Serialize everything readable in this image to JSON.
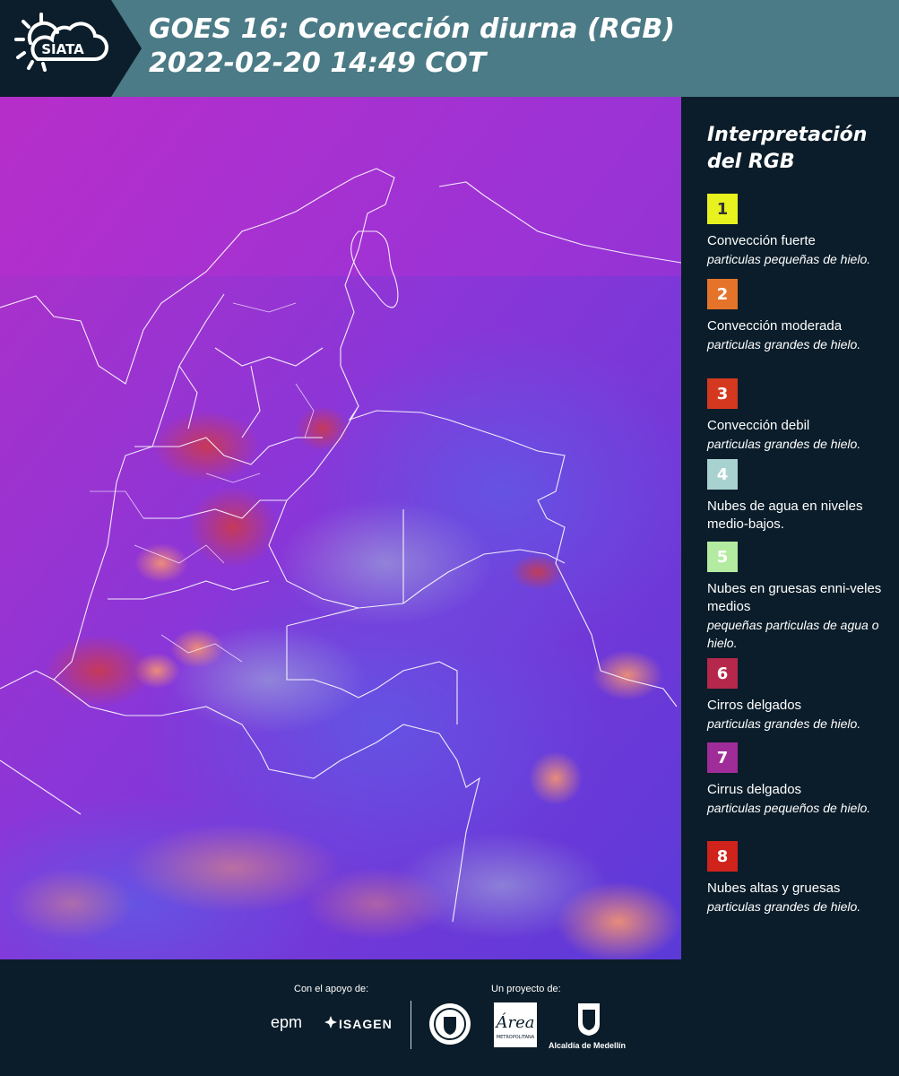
{
  "header": {
    "logo_text": "SIATA",
    "title": "GOES 16: Convección diurna (RGB)\n 2022-02-20 14:49 COT"
  },
  "legend": {
    "title": "Interpretación\ndel RGB",
    "items": [
      {
        "number": "1",
        "color": "#e8f21e",
        "label": "Convección fuerte",
        "desc": "particulas pequeñas de hielo.",
        "text_color": "#333333"
      },
      {
        "number": "2",
        "color": "#e5742a",
        "label": "Convección moderada",
        "desc": "particulas grandes de hielo.",
        "text_color": "#ffffff"
      },
      {
        "number": "3",
        "color": "#d4391f",
        "label": "Convección debil",
        "desc": "particulas grandes de hielo.",
        "text_color": "#ffffff"
      },
      {
        "number": "4",
        "color": "#a8d2cf",
        "label": "Nubes de agua en niveles medio-bajos.",
        "desc": "",
        "text_color": "#ffffff"
      },
      {
        "number": "5",
        "color": "#b3eba0",
        "label": "Nubes en gruesas enni-veles medios",
        "desc": "pequeñas particulas de agua o hielo.",
        "text_color": "#ffffff"
      },
      {
        "number": "6",
        "color": "#b5284b",
        "label": "Cirros delgados",
        "desc": "particulas grandes de hielo.",
        "text_color": "#ffffff"
      },
      {
        "number": "7",
        "color": "#9f2c98",
        "label": "Cirrus delgados",
        "desc": "particulas pequeños de hielo.",
        "text_color": "#ffffff"
      },
      {
        "number": "8",
        "color": "#d0231c",
        "label": "Nubes altas y gruesas",
        "desc": "particulas grandes de hielo.",
        "text_color": "#ffffff"
      }
    ]
  },
  "footer": {
    "support_caption": "Con el apoyo de:",
    "project_caption": "Un proyecto de:",
    "epm_logo": "epm",
    "isagen_logo": "ISAGEN",
    "area_logo": "Área",
    "area_sub": "METROPOLITANA",
    "alcaldia_logo": "Alcaldía de Medellín"
  },
  "map": {
    "image_type": "satellite-rgb-composite",
    "region": "Colombia"
  }
}
